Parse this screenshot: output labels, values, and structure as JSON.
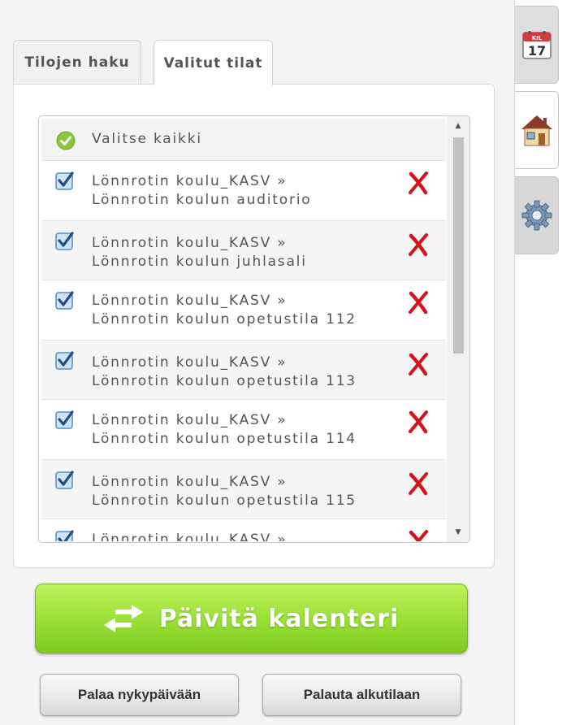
{
  "tabs": [
    {
      "label": "Tilojen haku",
      "active": false
    },
    {
      "label": "Valitut tilat",
      "active": true
    }
  ],
  "list": {
    "select_all_label": "Valitse kaikki",
    "items": [
      {
        "line1": "Lönnrotin koulu_KASV »",
        "line2": "Lönnrotin koulun auditorio",
        "checked": true
      },
      {
        "line1": "Lönnrotin koulu_KASV »",
        "line2": "Lönnrotin koulun juhlasali",
        "checked": true
      },
      {
        "line1": "Lönnrotin koulu_KASV »",
        "line2": "Lönnrotin koulun opetustila 112",
        "checked": true
      },
      {
        "line1": "Lönnrotin koulu_KASV »",
        "line2": "Lönnrotin koulun opetustila 113",
        "checked": true
      },
      {
        "line1": "Lönnrotin koulu_KASV »",
        "line2": "Lönnrotin koulun opetustila 114",
        "checked": true
      },
      {
        "line1": "Lönnrotin koulu_KASV »",
        "line2": "Lönnrotin koulun opetustila 115",
        "checked": true
      },
      {
        "line1": "Lönnrotin koulu_KASV »",
        "line2": "",
        "checked": true
      }
    ]
  },
  "buttons": {
    "update_calendar": "Päivitä kalenteri",
    "back_to_today": "Palaa nykypäivään",
    "reset": "Palauta alkutilaan"
  },
  "rail": {
    "calendar_day": "17",
    "calendar_month": "KIL",
    "icons": [
      "calendar-icon",
      "house-icon",
      "gear-icon"
    ]
  },
  "colors": {
    "green_button": "#8ed42c",
    "delete_x": "#d4141c",
    "checkbox": "#4f8fc8",
    "ok_badge": "#8cc63f"
  }
}
